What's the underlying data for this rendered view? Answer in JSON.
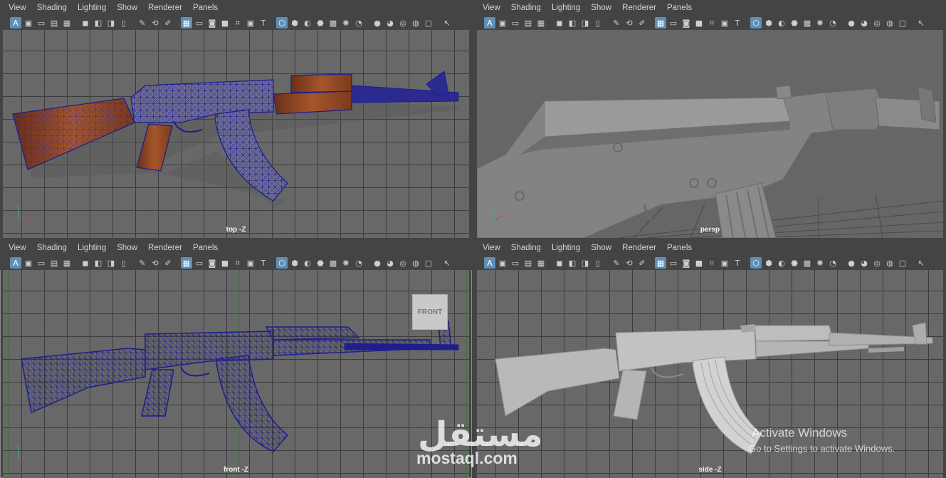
{
  "menu": [
    "View",
    "Shading",
    "Lighting",
    "Show",
    "Renderer",
    "Panels"
  ],
  "toolbar_icons": [
    {
      "name": "select-camera-icon",
      "glyph": "A",
      "active": true
    },
    {
      "name": "camera-attributes-icon",
      "glyph": "▣"
    },
    {
      "name": "bookmark-icon",
      "glyph": "▭"
    },
    {
      "name": "image-plane-icon",
      "glyph": "▤"
    },
    {
      "name": "2d-pan-zoom-icon",
      "glyph": "▦"
    },
    {
      "name": "camera-icon",
      "glyph": "◼",
      "gap": true
    },
    {
      "name": "lock-camera-icon",
      "glyph": "◧"
    },
    {
      "name": "film-gate-icon",
      "glyph": "◨"
    },
    {
      "name": "resolution-gate-icon",
      "glyph": "▯"
    },
    {
      "name": "field-chart-icon",
      "glyph": "✎",
      "gap": true
    },
    {
      "name": "safe-action-icon",
      "glyph": "⟲"
    },
    {
      "name": "safe-title-icon",
      "glyph": "✐"
    },
    {
      "name": "grid-icon",
      "glyph": "▦",
      "gap": true,
      "active": true
    },
    {
      "name": "film-gate-toggle-icon",
      "glyph": "▭"
    },
    {
      "name": "resolution-gate-toggle-icon",
      "glyph": "◙"
    },
    {
      "name": "gate-mask-icon",
      "glyph": "■"
    },
    {
      "name": "field-chart-toggle-icon",
      "glyph": "⌗"
    },
    {
      "name": "safe-action-toggle-icon",
      "glyph": "▣"
    },
    {
      "name": "safe-title-toggle-icon",
      "glyph": "T"
    },
    {
      "name": "wireframe-icon",
      "glyph": "⬡",
      "gap": true,
      "active": true
    },
    {
      "name": "smooth-shade-icon",
      "glyph": "⬢"
    },
    {
      "name": "default-material-icon",
      "glyph": "◐"
    },
    {
      "name": "wireframe-on-shaded-icon",
      "glyph": "⬣"
    },
    {
      "name": "xray-icon",
      "glyph": "▩"
    },
    {
      "name": "lights-icon",
      "glyph": "✺"
    },
    {
      "name": "shadows-icon",
      "glyph": "◔"
    },
    {
      "name": "ambient-occlusion-icon",
      "glyph": "●",
      "gap": true
    },
    {
      "name": "motion-blur-icon",
      "glyph": "◕"
    },
    {
      "name": "anti-aliasing-icon",
      "glyph": "◎"
    },
    {
      "name": "depth-of-field-icon",
      "glyph": "◍"
    },
    {
      "name": "isolate-select-icon",
      "glyph": "▢"
    },
    {
      "name": "pointer-icon",
      "glyph": "↖",
      "gap": true
    }
  ],
  "viewports": {
    "top": {
      "label": "top -Z"
    },
    "persp": {
      "label": "persp"
    },
    "front": {
      "label": "front -Z",
      "view_cube": "FRONT"
    },
    "side": {
      "label": "side -Z"
    }
  },
  "watermark": {
    "arabic": "مستقل",
    "latin": "mostaql.com"
  },
  "activation": {
    "line1": "Activate Windows",
    "line2": "Go to Settings to activate Windows."
  },
  "colors": {
    "wire_blue": "#1e1e8c",
    "wood": "#8c4524",
    "grid_bg": "#686868",
    "grid_line": "#3c3c3c",
    "active_icon": "#5d8fb8"
  }
}
